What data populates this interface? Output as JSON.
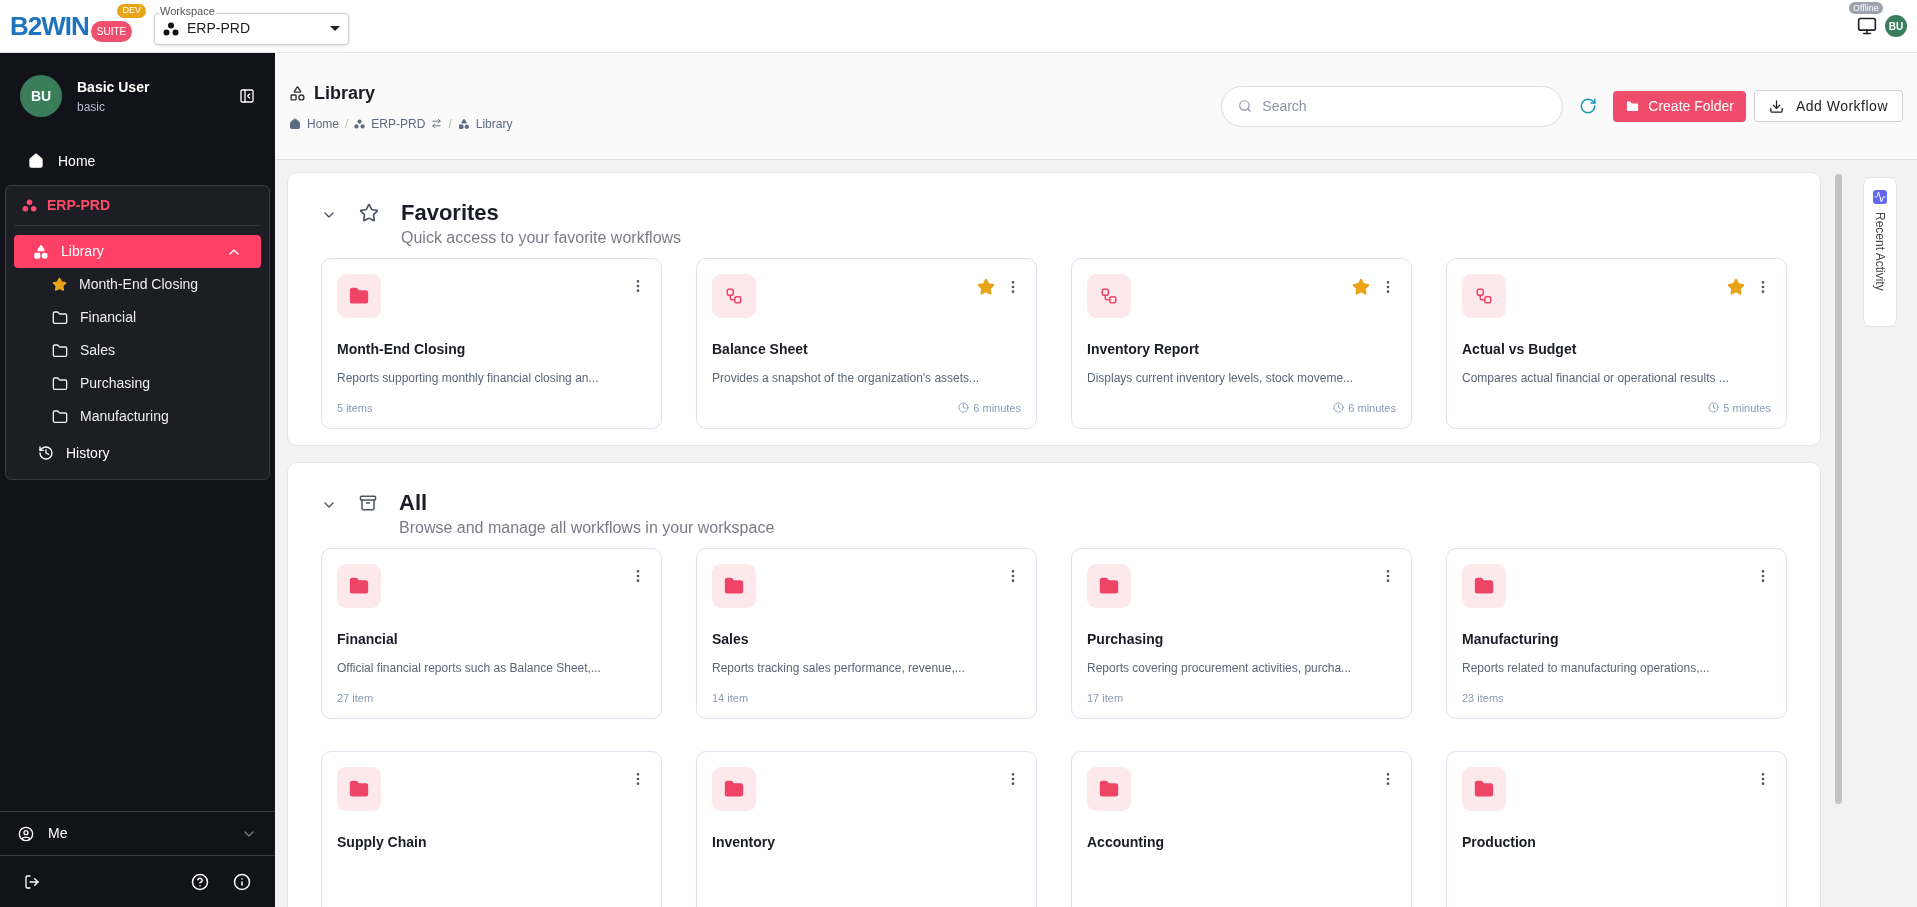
{
  "topbar": {
    "logo": {
      "brand": "B2WIN",
      "suite": "SUITE",
      "badge": "DEV"
    },
    "workspace": {
      "label": "Workspace",
      "value": "ERP-PRD"
    },
    "status": "Offline",
    "avatar": "BU"
  },
  "sidebar": {
    "user": {
      "initials": "BU",
      "name": "Basic User",
      "role": "basic"
    },
    "home": {
      "label": "Home"
    },
    "workspace": {
      "label": "ERP-PRD"
    },
    "library": {
      "label": "Library",
      "selected": true,
      "expanded": true,
      "children": [
        {
          "label": "Month-End Closing",
          "kind": "favorite"
        },
        {
          "label": "Financial",
          "kind": "folder"
        },
        {
          "label": "Sales",
          "kind": "folder"
        },
        {
          "label": "Purchasing",
          "kind": "folder"
        },
        {
          "label": "Manufacturing",
          "kind": "folder"
        }
      ]
    },
    "history": {
      "label": "History"
    },
    "me": {
      "label": "Me",
      "expanded": false
    }
  },
  "header": {
    "title": "Library",
    "breadcrumb_separator": "/",
    "breadcrumbs": [
      {
        "label": "Home",
        "kind": "home"
      },
      {
        "label": "ERP-PRD",
        "kind": "workspace"
      },
      {
        "label": "Library",
        "kind": "library"
      }
    ],
    "search": {
      "placeholder": "Search"
    },
    "create_button": "Create Folder",
    "add_button": "Add Workflow"
  },
  "sections": [
    {
      "kind": "favorites",
      "title": "Favorites",
      "subtitle": "Quick access to your favorite workflows",
      "expanded": true,
      "cards": [
        {
          "kind": "folder",
          "title": "Month-End Closing",
          "description": "Reports supporting monthly financial closing an...",
          "meta": "5 items",
          "favorite": false
        },
        {
          "kind": "workflow",
          "title": "Balance Sheet",
          "description": "Provides a snapshot of the organization's assets...",
          "meta": "6 minutes",
          "favorite": true
        },
        {
          "kind": "workflow",
          "title": "Inventory Report",
          "description": "Displays current inventory levels, stock moveme...",
          "meta": "6 minutes",
          "favorite": true
        },
        {
          "kind": "workflow",
          "title": "Actual vs Budget",
          "description": "Compares actual financial or operational results ...",
          "meta": "5 minutes",
          "favorite": true
        }
      ]
    },
    {
      "kind": "all",
      "title": "All",
      "subtitle": "Browse and manage all workflows in your workspace",
      "expanded": true,
      "cards": [
        {
          "kind": "folder",
          "title": "Financial",
          "description": "Official financial reports such as Balance Sheet,...",
          "meta": "27 item",
          "favorite": false
        },
        {
          "kind": "folder",
          "title": "Sales",
          "description": "Reports tracking sales performance, revenue,...",
          "meta": "14 item",
          "favorite": false
        },
        {
          "kind": "folder",
          "title": "Purchasing",
          "description": "Reports covering procurement activities, purcha...",
          "meta": "17 item",
          "favorite": false
        },
        {
          "kind": "folder",
          "title": "Manufacturing",
          "description": "Reports related to manufacturing operations,...",
          "meta": "23 items",
          "favorite": false
        },
        {
          "kind": "folder",
          "title": "Supply Chain",
          "favorite": false
        },
        {
          "kind": "folder",
          "title": "Inventory",
          "favorite": false
        },
        {
          "kind": "folder",
          "title": "Accounting",
          "favorite": false
        },
        {
          "kind": "folder",
          "title": "Production",
          "favorite": false
        }
      ]
    }
  ],
  "right_rail": {
    "label": "Recent Activity"
  }
}
